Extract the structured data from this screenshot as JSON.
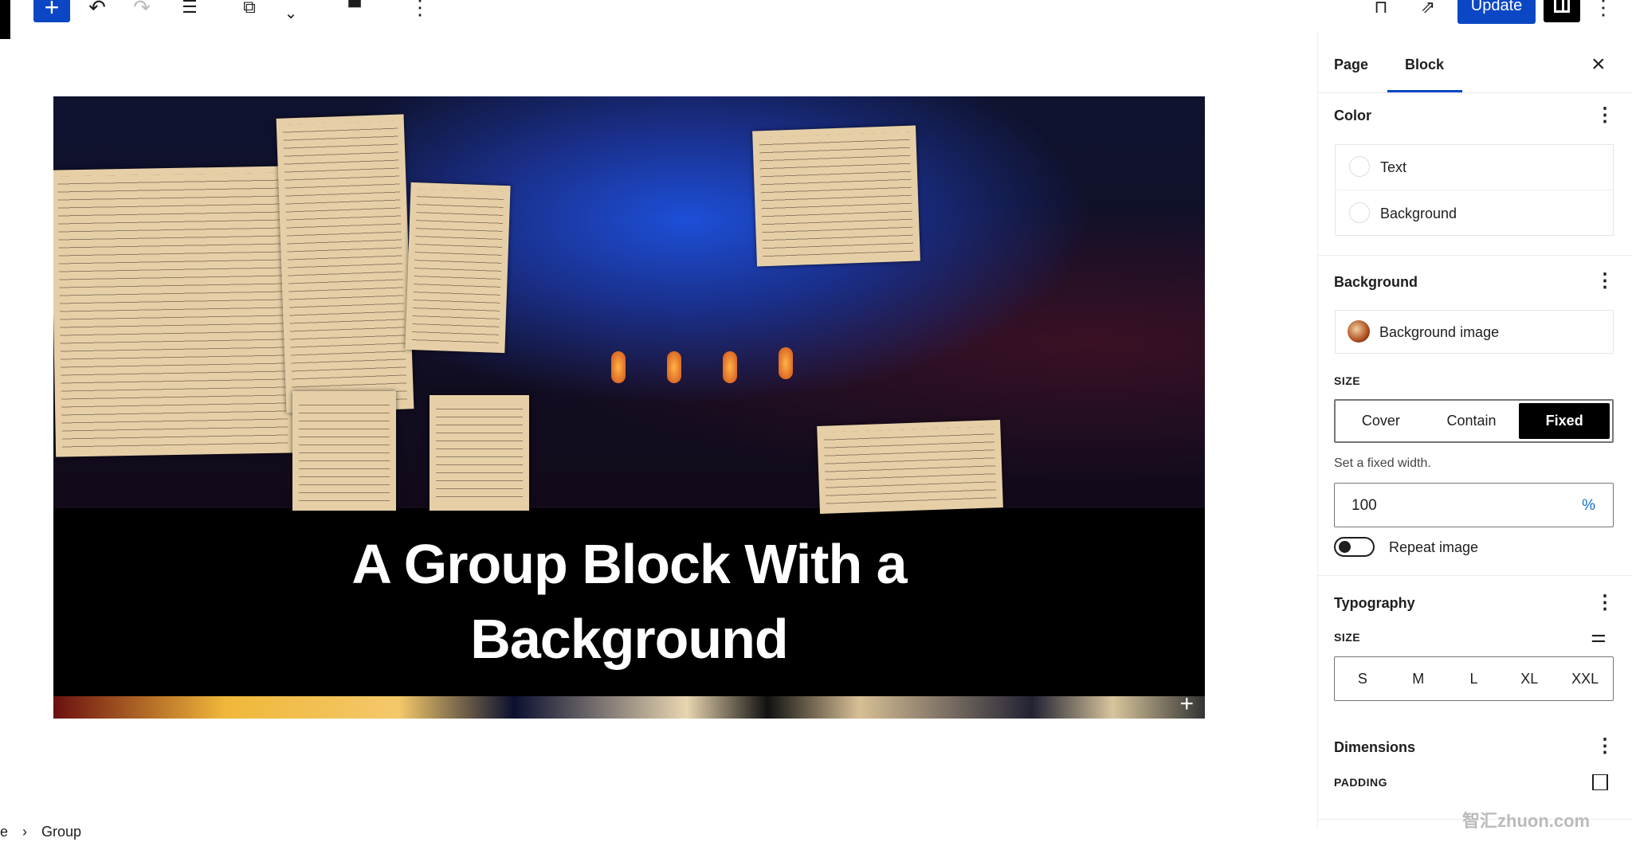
{
  "toolbar": {
    "add_label": "+",
    "undo_icon": "undo-icon",
    "redo_icon": "redo-icon",
    "update_label": "Update"
  },
  "canvas": {
    "heading_line1": "A Group Block With a",
    "heading_line2": "Background",
    "appender": "+"
  },
  "breadcrumb": {
    "items": [
      "e",
      "Group"
    ],
    "separator": "›"
  },
  "sidebar": {
    "tabs": [
      {
        "label": "Page"
      },
      {
        "label": "Block",
        "active": true
      }
    ],
    "close": "×",
    "color": {
      "title": "Color",
      "items": [
        "Text",
        "Background"
      ]
    },
    "background": {
      "title": "Background",
      "image_label": "Background image",
      "size_label": "SIZE",
      "size_options": [
        "Cover",
        "Contain",
        "Fixed"
      ],
      "selected": "Fixed",
      "help": "Set a fixed width.",
      "width_value": "100",
      "width_unit": "%",
      "repeat_label": "Repeat image",
      "repeat_on": false
    },
    "typography": {
      "title": "Typography",
      "size_label": "SIZE",
      "sizes": [
        "S",
        "M",
        "L",
        "XL",
        "XXL"
      ]
    },
    "dimensions": {
      "title": "Dimensions",
      "padding_label": "PADDING"
    }
  },
  "accent": "#0b47c4",
  "watermark": "智汇zhuon.com"
}
